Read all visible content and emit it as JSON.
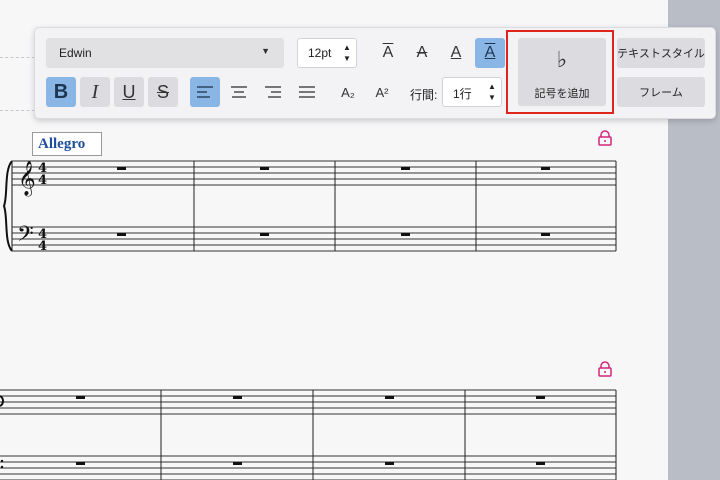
{
  "toolbar": {
    "font_name": "Edwin",
    "font_size": "12pt",
    "line_height_label": "行間:",
    "line_height_value": "1行",
    "add_symbol_label": "記号を追加",
    "text_style_label": "テキストスタイル",
    "frame_label": "フレーム",
    "bold_glyph": "B",
    "italic_glyph": "I",
    "underline_glyph": "U",
    "strike_glyph": "S",
    "subscript_glyph": "A₂",
    "superscript_glyph": "A²",
    "overline_glyph": "A",
    "strike_a_glyph": "A",
    "plain_a_glyph": "A",
    "box_a_glyph": "A",
    "flat_glyph": "♭"
  },
  "score": {
    "tempo_text": "Allegro",
    "time_signature": "4/4"
  },
  "colors": {
    "active_button": "#8ab6e6",
    "highlight_box": "#e0231c",
    "tempo_text": "#1d4e9c",
    "lock_icon": "#d0267a"
  }
}
